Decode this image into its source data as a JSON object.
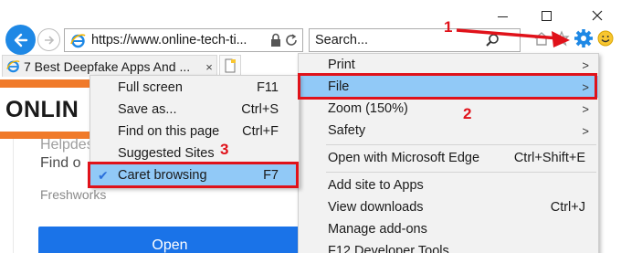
{
  "window": {
    "controls": [
      "minimize",
      "maximize",
      "close"
    ]
  },
  "address_bar": {
    "url": "https://www.online-tech-ti..."
  },
  "search_bar": {
    "placeholder": "Search..."
  },
  "tab": {
    "title": "7 Best Deepfake Apps And ...",
    "close_glyph": "×"
  },
  "page": {
    "logo_left": "ONLIN",
    "content_line_1": "Helpdesk",
    "content_line_2": "Find o",
    "brand": "Freshworks",
    "open_button": "Open"
  },
  "main_menu": {
    "items": [
      {
        "label": "Print",
        "shortcut": "",
        "submenu": true
      },
      {
        "label": "File",
        "shortcut": "",
        "submenu": true
      },
      {
        "label": "Zoom (150%)",
        "shortcut": "",
        "submenu": true
      },
      {
        "label": "Safety",
        "shortcut": "",
        "submenu": true
      },
      {
        "label": "Open with Microsoft Edge",
        "shortcut": "Ctrl+Shift+E",
        "submenu": false
      },
      {
        "label": "Add site to Apps",
        "shortcut": "",
        "submenu": false
      },
      {
        "label": "View downloads",
        "shortcut": "Ctrl+J",
        "submenu": false
      },
      {
        "label": "Manage add-ons",
        "shortcut": "",
        "submenu": false
      },
      {
        "label": "F12 Developer Tools",
        "shortcut": "",
        "submenu": false
      }
    ],
    "arrow_glyph": ">"
  },
  "file_submenu": {
    "items": [
      {
        "label": "Full screen",
        "shortcut": "F11"
      },
      {
        "label": "Save as...",
        "shortcut": "Ctrl+S"
      },
      {
        "label": "Find on this page",
        "shortcut": "Ctrl+F"
      },
      {
        "label": "Suggested Sites",
        "shortcut": ""
      },
      {
        "label": "Caret browsing",
        "shortcut": "F7",
        "checked": true
      }
    ],
    "check_glyph": "✔"
  },
  "annotations": {
    "step1": "1",
    "step2": "2",
    "step3": "3"
  },
  "colors": {
    "annotation_red": "#e0121a",
    "highlight_blue": "#91c9f7",
    "brand_orange": "#f07a2a",
    "open_button_blue": "#1a73e8"
  }
}
